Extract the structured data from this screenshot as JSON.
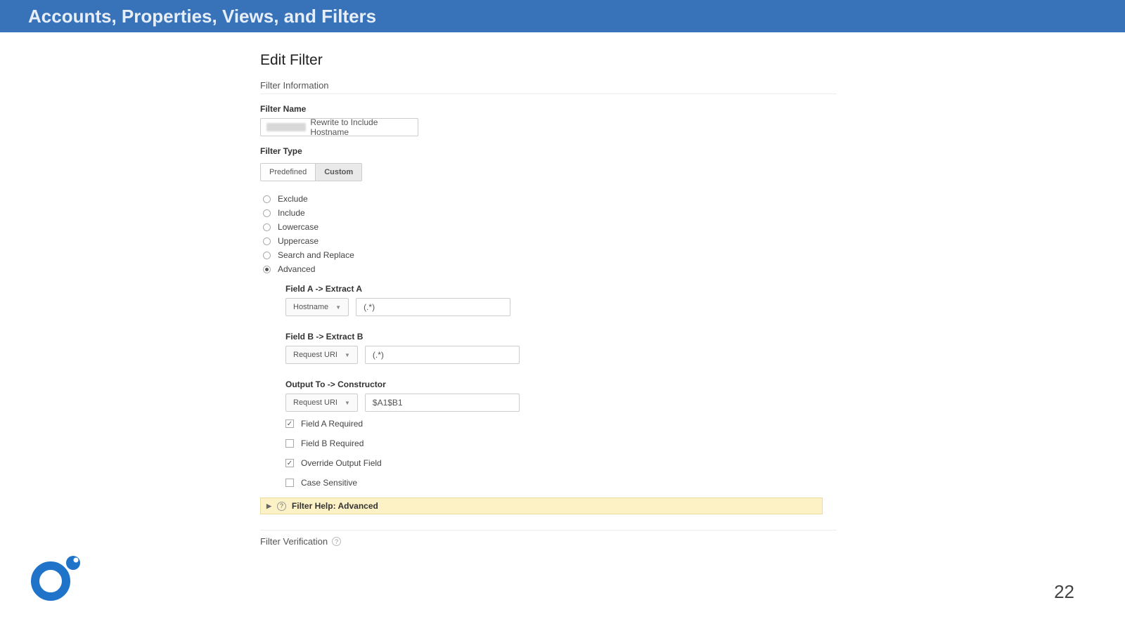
{
  "header": {
    "title": "Accounts, Properties, Views, and Filters"
  },
  "page": {
    "title": "Edit Filter",
    "number": "22"
  },
  "sections": {
    "info": "Filter Information",
    "verification": "Filter Verification"
  },
  "labels": {
    "filter_name": "Filter Name",
    "filter_type": "Filter Type"
  },
  "filter_name_value": "Rewrite to Include Hostname",
  "tabs": {
    "predefined": "Predefined",
    "custom": "Custom"
  },
  "radios": {
    "exclude": "Exclude",
    "include": "Include",
    "lowercase": "Lowercase",
    "uppercase": "Uppercase",
    "search_replace": "Search and Replace",
    "advanced": "Advanced"
  },
  "advanced": {
    "field_a_label": "Field A -> Extract A",
    "field_a_select": "Hostname",
    "field_a_value": "(.*)",
    "field_b_label": "Field B -> Extract B",
    "field_b_select": "Request URI",
    "field_b_value": "(.*)",
    "output_label": "Output To -> Constructor",
    "output_select": "Request URI",
    "output_value": "$A1$B1"
  },
  "checks": {
    "field_a_required": "Field A Required",
    "field_b_required": "Field B Required",
    "override_output": "Override Output Field",
    "case_sensitive": "Case Sensitive"
  },
  "help": {
    "label": "Filter Help: Advanced"
  },
  "colors": {
    "accent": "#3873b9",
    "help_bg": "#fdf2c6",
    "logo": "#1f73c9"
  }
}
